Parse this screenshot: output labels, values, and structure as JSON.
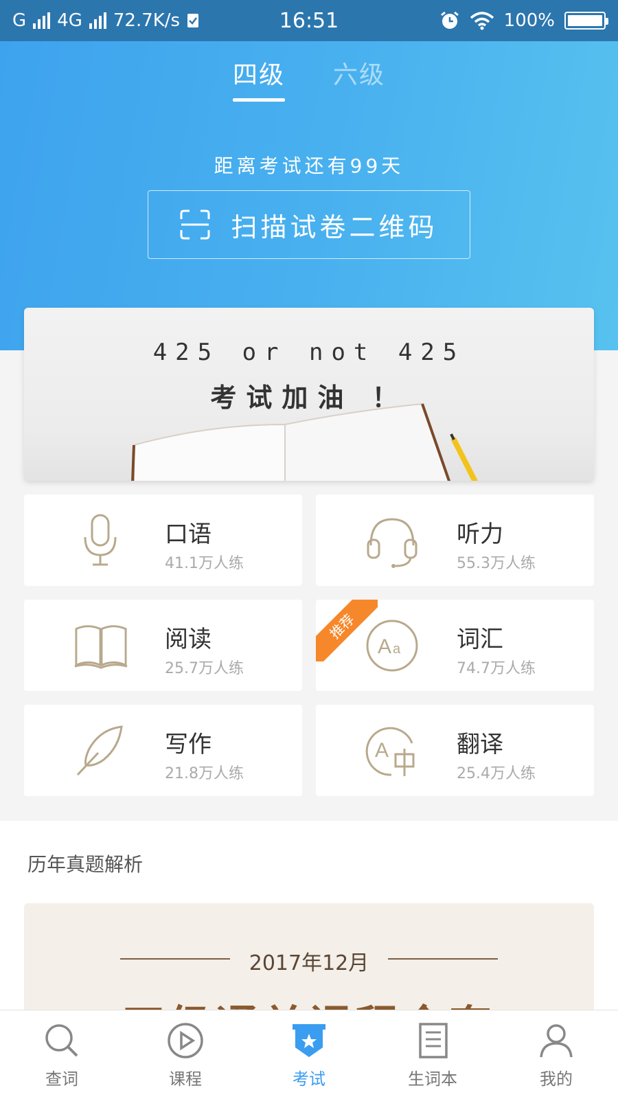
{
  "status_bar": {
    "carrier1": "G",
    "carrier2": "4G",
    "speed": "72.7K/s",
    "time": "16:51",
    "battery": "100%"
  },
  "header": {
    "tabs": [
      {
        "label": "四级",
        "active": true
      },
      {
        "label": "六级",
        "active": false
      }
    ],
    "countdown": "距离考试还有99天",
    "scan_button": "扫描试卷二维码"
  },
  "banner": {
    "line1": "425 or not 425",
    "line2": "考试加油 ！"
  },
  "practice": [
    {
      "title": "口语",
      "count": "41.1万人练",
      "icon": "microphone-icon"
    },
    {
      "title": "听力",
      "count": "55.3万人练",
      "icon": "headset-icon"
    },
    {
      "title": "阅读",
      "count": "25.7万人练",
      "icon": "book-icon"
    },
    {
      "title": "词汇",
      "count": "74.7万人练",
      "icon": "vocabulary-icon",
      "badge": "推荐"
    },
    {
      "title": "写作",
      "count": "21.8万人练",
      "icon": "quill-icon"
    },
    {
      "title": "翻译",
      "count": "25.4万人练",
      "icon": "translate-icon"
    }
  ],
  "past_papers": {
    "title": "历年真题解析",
    "banner_date": "2017年12月",
    "banner_title": "四级通关课程全套"
  },
  "tabbar": [
    {
      "label": "查词",
      "icon": "search-icon",
      "active": false
    },
    {
      "label": "课程",
      "icon": "play-icon",
      "active": false
    },
    {
      "label": "考试",
      "icon": "exam-icon",
      "active": true
    },
    {
      "label": "生词本",
      "icon": "notebook-icon",
      "active": false
    },
    {
      "label": "我的",
      "icon": "user-icon",
      "active": false
    }
  ],
  "colors": {
    "accent": "#3a9df0",
    "icon_gold": "#b8a98c",
    "badge_orange": "#f6872a"
  }
}
